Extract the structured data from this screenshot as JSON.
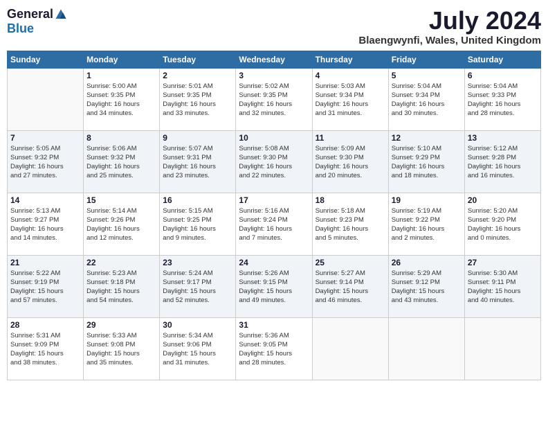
{
  "logo": {
    "general": "General",
    "blue": "Blue"
  },
  "title": "July 2024",
  "location": "Blaengwynfi, Wales, United Kingdom",
  "days_of_week": [
    "Sunday",
    "Monday",
    "Tuesday",
    "Wednesday",
    "Thursday",
    "Friday",
    "Saturday"
  ],
  "weeks": [
    [
      {
        "day": null,
        "info": null
      },
      {
        "day": "1",
        "info": "Sunrise: 5:00 AM\nSunset: 9:35 PM\nDaylight: 16 hours\nand 34 minutes."
      },
      {
        "day": "2",
        "info": "Sunrise: 5:01 AM\nSunset: 9:35 PM\nDaylight: 16 hours\nand 33 minutes."
      },
      {
        "day": "3",
        "info": "Sunrise: 5:02 AM\nSunset: 9:35 PM\nDaylight: 16 hours\nand 32 minutes."
      },
      {
        "day": "4",
        "info": "Sunrise: 5:03 AM\nSunset: 9:34 PM\nDaylight: 16 hours\nand 31 minutes."
      },
      {
        "day": "5",
        "info": "Sunrise: 5:04 AM\nSunset: 9:34 PM\nDaylight: 16 hours\nand 30 minutes."
      },
      {
        "day": "6",
        "info": "Sunrise: 5:04 AM\nSunset: 9:33 PM\nDaylight: 16 hours\nand 28 minutes."
      }
    ],
    [
      {
        "day": "7",
        "info": "Sunrise: 5:05 AM\nSunset: 9:32 PM\nDaylight: 16 hours\nand 27 minutes."
      },
      {
        "day": "8",
        "info": "Sunrise: 5:06 AM\nSunset: 9:32 PM\nDaylight: 16 hours\nand 25 minutes."
      },
      {
        "day": "9",
        "info": "Sunrise: 5:07 AM\nSunset: 9:31 PM\nDaylight: 16 hours\nand 23 minutes."
      },
      {
        "day": "10",
        "info": "Sunrise: 5:08 AM\nSunset: 9:30 PM\nDaylight: 16 hours\nand 22 minutes."
      },
      {
        "day": "11",
        "info": "Sunrise: 5:09 AM\nSunset: 9:30 PM\nDaylight: 16 hours\nand 20 minutes."
      },
      {
        "day": "12",
        "info": "Sunrise: 5:10 AM\nSunset: 9:29 PM\nDaylight: 16 hours\nand 18 minutes."
      },
      {
        "day": "13",
        "info": "Sunrise: 5:12 AM\nSunset: 9:28 PM\nDaylight: 16 hours\nand 16 minutes."
      }
    ],
    [
      {
        "day": "14",
        "info": "Sunrise: 5:13 AM\nSunset: 9:27 PM\nDaylight: 16 hours\nand 14 minutes."
      },
      {
        "day": "15",
        "info": "Sunrise: 5:14 AM\nSunset: 9:26 PM\nDaylight: 16 hours\nand 12 minutes."
      },
      {
        "day": "16",
        "info": "Sunrise: 5:15 AM\nSunset: 9:25 PM\nDaylight: 16 hours\nand 9 minutes."
      },
      {
        "day": "17",
        "info": "Sunrise: 5:16 AM\nSunset: 9:24 PM\nDaylight: 16 hours\nand 7 minutes."
      },
      {
        "day": "18",
        "info": "Sunrise: 5:18 AM\nSunset: 9:23 PM\nDaylight: 16 hours\nand 5 minutes."
      },
      {
        "day": "19",
        "info": "Sunrise: 5:19 AM\nSunset: 9:22 PM\nDaylight: 16 hours\nand 2 minutes."
      },
      {
        "day": "20",
        "info": "Sunrise: 5:20 AM\nSunset: 9:20 PM\nDaylight: 16 hours\nand 0 minutes."
      }
    ],
    [
      {
        "day": "21",
        "info": "Sunrise: 5:22 AM\nSunset: 9:19 PM\nDaylight: 15 hours\nand 57 minutes."
      },
      {
        "day": "22",
        "info": "Sunrise: 5:23 AM\nSunset: 9:18 PM\nDaylight: 15 hours\nand 54 minutes."
      },
      {
        "day": "23",
        "info": "Sunrise: 5:24 AM\nSunset: 9:17 PM\nDaylight: 15 hours\nand 52 minutes."
      },
      {
        "day": "24",
        "info": "Sunrise: 5:26 AM\nSunset: 9:15 PM\nDaylight: 15 hours\nand 49 minutes."
      },
      {
        "day": "25",
        "info": "Sunrise: 5:27 AM\nSunset: 9:14 PM\nDaylight: 15 hours\nand 46 minutes."
      },
      {
        "day": "26",
        "info": "Sunrise: 5:29 AM\nSunset: 9:12 PM\nDaylight: 15 hours\nand 43 minutes."
      },
      {
        "day": "27",
        "info": "Sunrise: 5:30 AM\nSunset: 9:11 PM\nDaylight: 15 hours\nand 40 minutes."
      }
    ],
    [
      {
        "day": "28",
        "info": "Sunrise: 5:31 AM\nSunset: 9:09 PM\nDaylight: 15 hours\nand 38 minutes."
      },
      {
        "day": "29",
        "info": "Sunrise: 5:33 AM\nSunset: 9:08 PM\nDaylight: 15 hours\nand 35 minutes."
      },
      {
        "day": "30",
        "info": "Sunrise: 5:34 AM\nSunset: 9:06 PM\nDaylight: 15 hours\nand 31 minutes."
      },
      {
        "day": "31",
        "info": "Sunrise: 5:36 AM\nSunset: 9:05 PM\nDaylight: 15 hours\nand 28 minutes."
      },
      {
        "day": null,
        "info": null
      },
      {
        "day": null,
        "info": null
      },
      {
        "day": null,
        "info": null
      }
    ]
  ]
}
